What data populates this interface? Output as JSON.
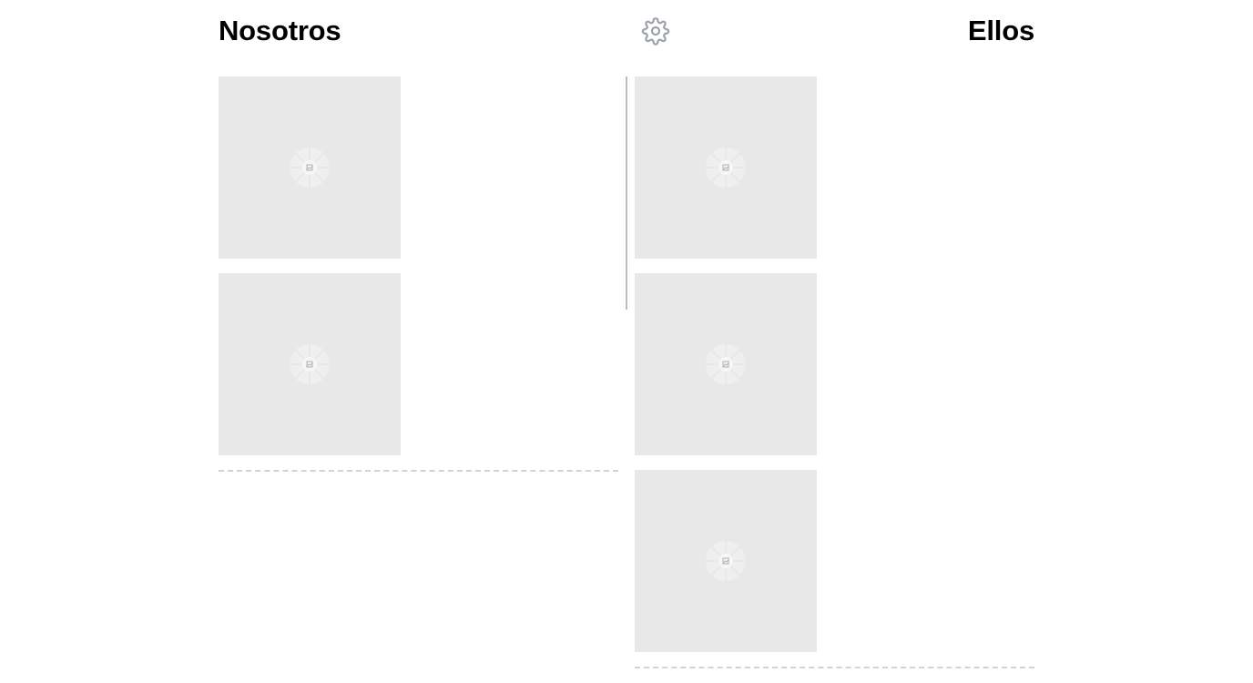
{
  "teams": {
    "left": {
      "title": "Nosotros",
      "cards": 2
    },
    "right": {
      "title": "Ellos",
      "cards": 3
    }
  },
  "icons": {
    "settings": "gear-icon",
    "card_placeholder": "image-placeholder-icon"
  },
  "colors": {
    "card_bg": "#e8e8e8",
    "divider": "#bdbdbd",
    "dash": "#d3d3d3",
    "gear": "#9aa0a6"
  }
}
